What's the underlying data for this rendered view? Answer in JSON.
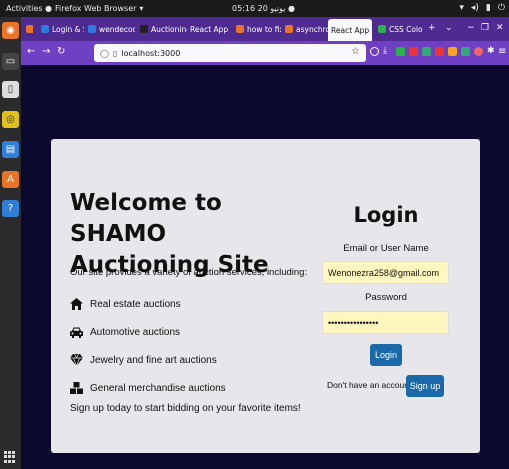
{
  "system_bar": {
    "activities": "Activities",
    "app_name": "Firefox Web Browser",
    "clock": "يونيو 20 05:16"
  },
  "browser": {
    "tabs": [
      {
        "label": "Login & Sig",
        "color": "#2d7de0"
      },
      {
        "label": "wendecode",
        "color": "#2d7de0"
      },
      {
        "label": "Auctioning",
        "color": "#222222"
      },
      {
        "label": "React App",
        "color": "#4e2a91"
      },
      {
        "label": "how to fix t",
        "color": "#e8742a"
      },
      {
        "label": "asynchrono",
        "color": "#e8742a"
      },
      {
        "label": "React App",
        "color": "#4e2a91"
      },
      {
        "label": "CSS Colors",
        "color": "#2bb24c"
      }
    ],
    "active_tab_index": 6,
    "url": "localhost:3000"
  },
  "page": {
    "welcome_title": "Welcome to SHAMO Auctioning Site",
    "intro": "Our site provides a variety of auction services, including:",
    "services": [
      {
        "icon": "home-icon",
        "label": "Real estate auctions"
      },
      {
        "icon": "car-icon",
        "label": "Automotive auctions"
      },
      {
        "icon": "diamond-icon",
        "label": "Jewelry and fine art auctions"
      },
      {
        "icon": "boxes-icon",
        "label": "General merchandise auctions"
      }
    ],
    "cta": "Sign up today to start bidding on your favorite items!"
  },
  "login": {
    "title": "Login",
    "email_label": "Email or User Name",
    "email_value": "Wenonezra258@gmail.com",
    "password_label": "Password",
    "password_value": "••••••••••••••••",
    "login_button": "Login",
    "no_account_text": "Don't have an account?",
    "signup_button": "Sign up"
  },
  "colors": {
    "page_background": "#0b0a2e",
    "card_background": "#e7e6ea",
    "input_background": "#fff7bf",
    "button": "#1a6aa9",
    "tab_bar": "#4e2a91",
    "nav_bar": "#6f3fc4"
  }
}
